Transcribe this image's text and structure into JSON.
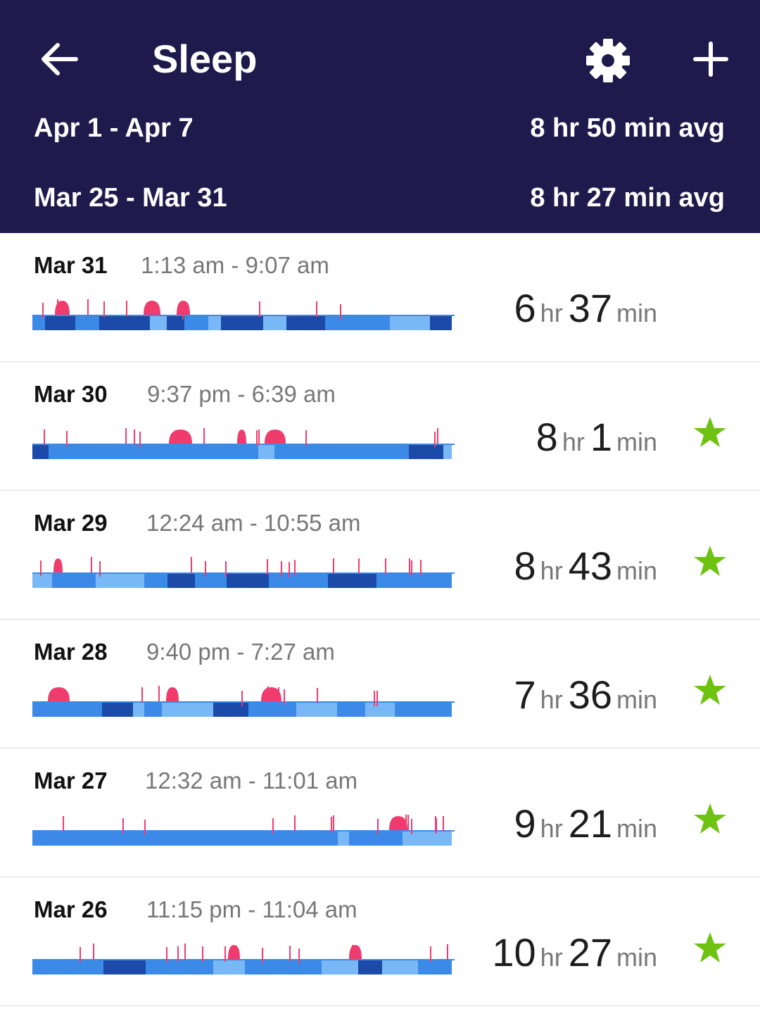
{
  "header": {
    "title": "Sleep",
    "back_icon": "arrow-left-icon",
    "settings_icon": "gear-icon",
    "add_icon": "plus-icon"
  },
  "weeks": [
    {
      "range": "Apr 1 - Apr 7",
      "avg": "8 hr 50 min avg"
    },
    {
      "range": "Mar 25 - Mar 31",
      "avg": "8 hr 27 min avg"
    }
  ],
  "colors": {
    "header_bg": "#1f1a4c",
    "awake": "#ef3c6d",
    "rem": "#79b8f7",
    "light": "#3c8ae8",
    "deep": "#1b4aa8",
    "star": "#6ec312"
  },
  "nights": [
    {
      "date": "Mar 31",
      "time": "1:13 am - 9:07 am",
      "hours": "6",
      "minutes": "37",
      "hr_unit": "hr",
      "min_unit": "min",
      "goal_met": false
    },
    {
      "date": "Mar 30",
      "time": "9:37 pm - 6:39 am",
      "hours": "8",
      "minutes": "1",
      "hr_unit": "hr",
      "min_unit": "min",
      "goal_met": true
    },
    {
      "date": "Mar 29",
      "time": "12:24 am - 10:55 am",
      "hours": "8",
      "minutes": "43",
      "hr_unit": "hr",
      "min_unit": "min",
      "goal_met": true
    },
    {
      "date": "Mar 28",
      "time": "9:40 pm - 7:27 am",
      "hours": "7",
      "minutes": "36",
      "hr_unit": "hr",
      "min_unit": "min",
      "goal_met": true
    },
    {
      "date": "Mar 27",
      "time": "12:32 am - 11:01 am",
      "hours": "9",
      "minutes": "21",
      "hr_unit": "hr",
      "min_unit": "min",
      "goal_met": true
    },
    {
      "date": "Mar 26",
      "time": "11:15 pm - 11:04 am",
      "hours": "10",
      "minutes": "27",
      "hr_unit": "hr",
      "min_unit": "min",
      "goal_met": true
    }
  ]
}
